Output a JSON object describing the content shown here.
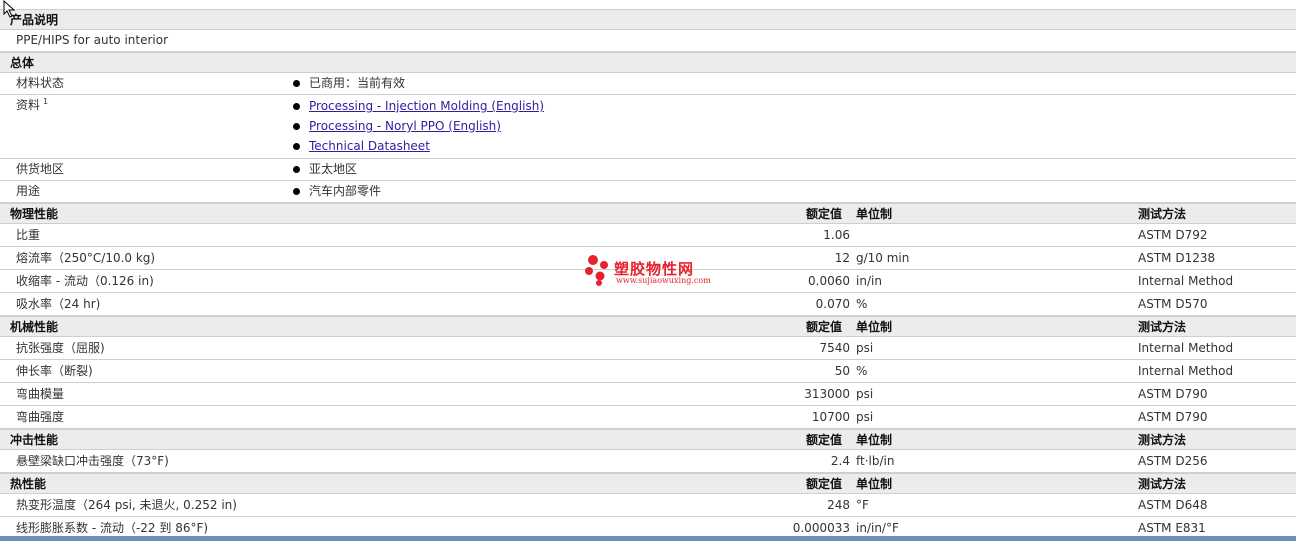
{
  "columns": {
    "value": "额定值",
    "unit": "单位制",
    "method": "测试方法"
  },
  "product": {
    "title": "产品说明",
    "description": "PPE/HIPS for auto interior"
  },
  "general": {
    "title": "总体",
    "status_label": "材料状态",
    "status_value": "已商用：当前有效",
    "docs_label": "资料",
    "docs_sup": "1",
    "docs": [
      "Processing - Injection Molding (English)",
      "Processing - Noryl PPO (English)",
      "Technical Datasheet"
    ],
    "region_label": "供货地区",
    "region_value": "亚太地区",
    "use_label": "用途",
    "use_value": "汽车内部零件"
  },
  "physical": {
    "title": "物理性能",
    "rows": [
      {
        "name": "比重",
        "value": "1.06",
        "unit": "",
        "method": "ASTM D792"
      },
      {
        "name": "熔流率（250°C/10.0 kg)",
        "value": "12",
        "unit": "g/10 min",
        "method": "ASTM D1238"
      },
      {
        "name": "收缩率 - 流动（0.126 in)",
        "value": "0.0060",
        "unit": "in/in",
        "method": "Internal Method"
      },
      {
        "name": "吸水率（24 hr)",
        "value": "0.070",
        "unit": "%",
        "method": "ASTM D570"
      }
    ]
  },
  "mechanical": {
    "title": "机械性能",
    "rows": [
      {
        "name": "抗张强度（屈服)",
        "value": "7540",
        "unit": "psi",
        "method": "Internal Method"
      },
      {
        "name": "伸长率（断裂)",
        "value": "50",
        "unit": "%",
        "method": "Internal Method"
      },
      {
        "name": "弯曲模量",
        "value": "313000",
        "unit": "psi",
        "method": "ASTM D790"
      },
      {
        "name": "弯曲强度",
        "value": "10700",
        "unit": "psi",
        "method": "ASTM D790"
      }
    ]
  },
  "impact": {
    "title": "冲击性能",
    "rows": [
      {
        "name": "悬壁梁缺口冲击强度（73°F)",
        "value": "2.4",
        "unit": "ft·lb/in",
        "method": "ASTM D256"
      }
    ]
  },
  "thermal": {
    "title": "热性能",
    "rows": [
      {
        "name": "热变形温度（264 psi, 未退火, 0.252 in)",
        "value": "248",
        "unit": "°F",
        "method": "ASTM D648"
      },
      {
        "name": "线形膨胀系数 - 流动（-22 到 86°F)",
        "value": "0.000033",
        "unit": "in/in/°F",
        "method": "ASTM E831"
      }
    ]
  },
  "watermark": {
    "name": "塑胶物性网",
    "url": "www.sujiaowuxing.com",
    "color": "#e8212e"
  },
  "accent": {
    "link": "#2d1fa0",
    "section_bg": "#ececec",
    "bottom_bar": "#6b8fb5"
  }
}
